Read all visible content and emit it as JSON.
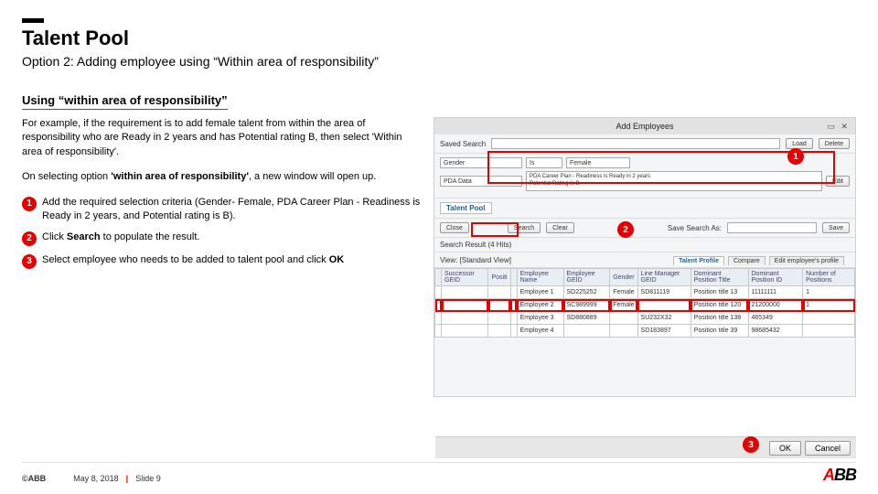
{
  "header": {
    "title": "Talent Pool",
    "subtitle": "Option 2: Adding employee using “Within area of responsibility”"
  },
  "section_heading": "Using “within area of responsibility”",
  "para1": "For example, if the requirement is to add female talent  from within the area of responsibility who are Ready in 2 years and has Potential rating B, then select 'Within area of responsibility'.",
  "para2_a": "On selecting option ",
  "para2_b": "'within area of responsibility'",
  "para2_c": ", a new window will open up.",
  "steps": [
    {
      "num": "1",
      "text": "Add the required selection criteria (Gender- Female, PDA Career Plan - Readiness is Ready in 2 years, and  Potential rating is B)."
    },
    {
      "num": "2",
      "text_a": "Click ",
      "bold": "Search",
      "text_b": " to populate the result."
    },
    {
      "num": "3",
      "text_a": "Select employee who needs to be added to talent pool and click ",
      "bold": "OK"
    }
  ],
  "screenshot": {
    "window_title": "Add Employees",
    "saved_search_label": "Saved Search",
    "load_btn": "Load",
    "delete_btn": "Delete",
    "crit1_field": "Gender",
    "crit1_op": "Is",
    "crit1_val": "Female",
    "crit2_field": "PDA Data",
    "crit2_text": "PDA Career Plan - Readiness is Ready in 2 years\nPotential Rating Is B",
    "edit_btn": "Edit",
    "talent_pool_tab": "Talent Pool",
    "close_btn": "Close",
    "search_btn": "Search",
    "clear_btn": "Clear",
    "save_as_label": "Save Search As:",
    "save_btn": "Save",
    "result_header": "Search Result (4 Hits)",
    "view_label": "View: [Standard View]",
    "tabs": [
      "Talent Profile",
      "Compare",
      "Edit employee's profile"
    ],
    "columns": [
      "",
      "Successor GEID",
      "Positi",
      "",
      "Employee Name",
      "Employee GEID",
      "Gender",
      "Line Manager GEID",
      "Dominant Position Title",
      "Dominant Position ID",
      "Number of Positions"
    ],
    "rows": [
      [
        "",
        "",
        "",
        "",
        "Employee 1",
        "SD225252",
        "Female",
        "SD811119",
        "Position title 13",
        "11111111",
        "1"
      ],
      [
        "",
        "",
        "",
        "",
        "Employee 2",
        "SC989999",
        "Female",
        "",
        "Position title 120",
        "21200000",
        "1"
      ],
      [
        "",
        "",
        "",
        "",
        "Employee 3",
        "SD880889",
        "",
        "SU232X32",
        "Position title 138",
        "465349",
        ""
      ],
      [
        "",
        "",
        "",
        "",
        "Employee 4",
        "",
        "",
        "SD183897",
        "Position title 39",
        "98685432",
        ""
      ]
    ],
    "ok": "OK",
    "cancel": "Cancel"
  },
  "markers": {
    "m1": "1",
    "m2": "2",
    "m3": "3"
  },
  "footer": {
    "copyright": "©ABB",
    "date": "May 8, 2018",
    "slide": "Slide 9",
    "logo_a": "A",
    "logo_bb": "BB"
  }
}
